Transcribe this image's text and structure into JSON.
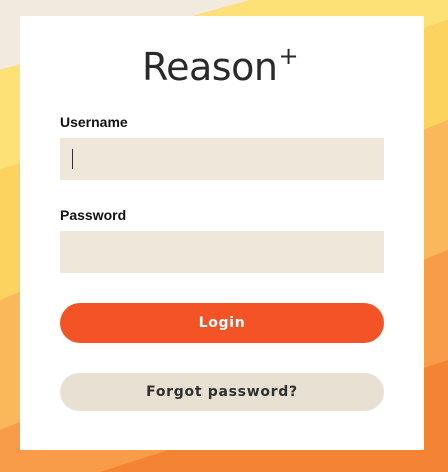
{
  "brand": {
    "name": "Reason",
    "suffix": "+"
  },
  "form": {
    "username": {
      "label": "Username",
      "value": "",
      "placeholder": ""
    },
    "password": {
      "label": "Password",
      "value": "",
      "placeholder": ""
    },
    "login_label": "Login",
    "forgot_label": "Forgot password?"
  },
  "colors": {
    "primary": "#f35325",
    "input_bg": "#efe7da",
    "secondary_button": "#e8e0d3",
    "background_warm": "#f7a44a"
  }
}
